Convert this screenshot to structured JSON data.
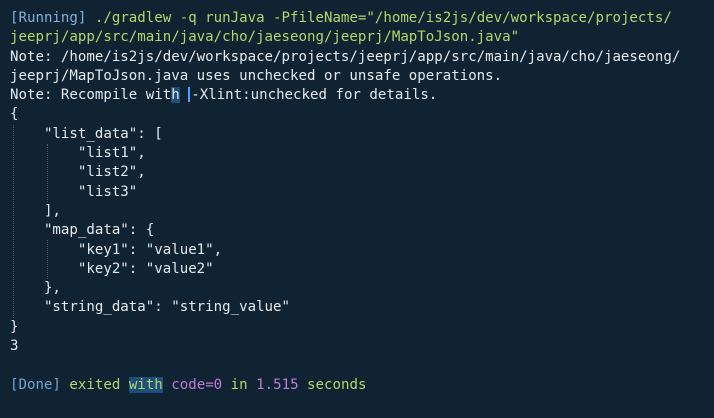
{
  "terminal": {
    "command_line_1": {
      "tag": "[Running]",
      "text": " ./gradlew -q runJava -PfileName=\"/home/is2js/dev/workspace/projects/"
    },
    "command_line_2": "jeeprj/app/src/main/java/cho/jaeseong/jeeprj/MapToJson.java\"",
    "note_line_1": "Note: /home/is2js/dev/workspace/projects/jeeprj/app/src/main/java/cho/jaeseong/",
    "note_line_2": "jeeprj/MapToJson.java uses unchecked or unsafe operations.",
    "note_line_3_before": "Note: Recompile wit",
    "note_line_3_hl": "h",
    "note_line_3_space": " ",
    "note_line_3_after": "-Xlint:unchecked for details.",
    "json_lines": [
      "{",
      "    \"list_data\": [",
      "        \"list1\",",
      "        \"list2\",",
      "        \"list3\"",
      "    ],",
      "    \"map_data\": {",
      "        \"key1\": \"value1\",",
      "        \"key2\": \"value2\"",
      "    },",
      "    \"string_data\": \"string_value\"",
      "}"
    ],
    "result_value": "3",
    "done": {
      "tag": "[Done]",
      "exited": " exited ",
      "with": "with",
      "code": " code=0",
      "in": " in ",
      "seconds_value": "1.515",
      "seconds_label": " seconds"
    }
  }
}
